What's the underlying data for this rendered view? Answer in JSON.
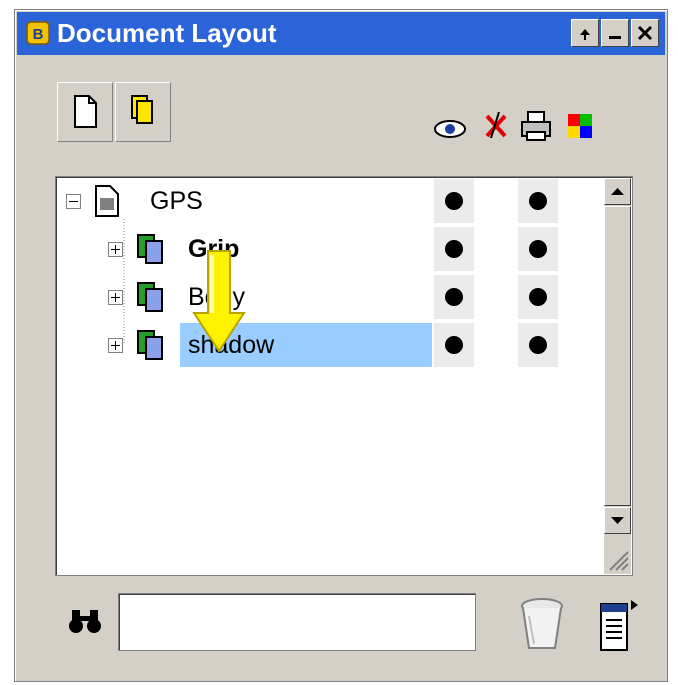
{
  "window": {
    "title": "Document Layout"
  },
  "titlebar_buttons": [
    "pin-icon",
    "minimize-icon",
    "close-icon"
  ],
  "toolbar": {
    "buttons": [
      "new-layer-icon",
      "duplicate-layer-icon"
    ]
  },
  "column_icons": [
    "eye-icon",
    "select-lock-icon",
    "printer-icon",
    "color-icon"
  ],
  "tree": {
    "rows": [
      {
        "label": "GPS",
        "bold": true,
        "expander": "minus",
        "type": "document",
        "visible": true,
        "printable": true
      },
      {
        "label": "Grip",
        "bold": true,
        "expander": "plus",
        "type": "layer",
        "visible": true,
        "printable": true
      },
      {
        "label": "Body",
        "bold": false,
        "expander": "plus",
        "type": "layer",
        "visible": true,
        "printable": true
      },
      {
        "label": "shadow",
        "bold": false,
        "expander": "plus",
        "type": "layer",
        "selected": true,
        "visible": true,
        "printable": true
      }
    ]
  },
  "drag_indicator": "yellow-down-arrow",
  "search": {
    "value": "",
    "placeholder": ""
  },
  "colors": {
    "titlebar": "#2b64d8",
    "selection": "#99ccff",
    "frame": "#d4d0c8"
  }
}
